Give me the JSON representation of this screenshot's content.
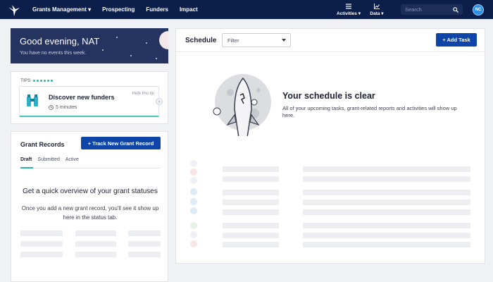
{
  "nav": {
    "items": [
      "Grants Management ▾",
      "Prospecting",
      "Funders",
      "Impact"
    ],
    "activities_label": "Activities ▾",
    "data_label": "Data ▾",
    "search_placeholder": "Search",
    "avatar_initials": "NC"
  },
  "greeting": {
    "title": "Good evening, NAT",
    "subtitle": "You have no events this week."
  },
  "tips": {
    "label": "TIPS",
    "card_title": "Discover new funders",
    "card_time": "5 minutes",
    "hide": "Hide this tip"
  },
  "records": {
    "title": "Grant Records",
    "track_button": "+ Track New Grant Record",
    "tabs": [
      "Draft",
      "Submitted",
      "Active"
    ],
    "heading": "Get a quick overview of your grant statuses",
    "body": "Once you add a new grant record, you'll see it show up here in the status tab."
  },
  "schedule": {
    "title": "Schedule",
    "filter_value": "Filter",
    "add_button": "+ Add Task",
    "clear_heading": "Your schedule is clear",
    "clear_body": "All of your upcoming tasks, grant-related reports and activities will show up here."
  },
  "colors": {
    "nav_bg": "#0c1f4a",
    "primary": "#0f45a9",
    "accent": "#2bb5a5",
    "greeting_bg": "#24335f"
  }
}
